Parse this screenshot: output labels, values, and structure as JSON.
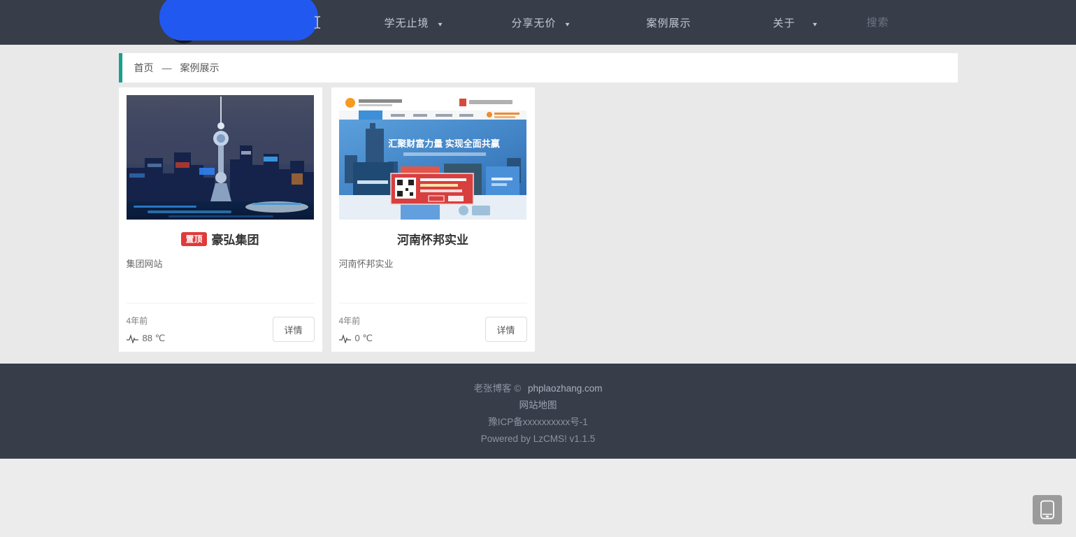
{
  "navbar": {
    "items": [
      {
        "label": "学无止境",
        "dropdown": true
      },
      {
        "label": "分享无价",
        "dropdown": true
      },
      {
        "label": "案例展示",
        "dropdown": false
      },
      {
        "label": "关于",
        "dropdown": true
      }
    ],
    "search_placeholder": "搜索"
  },
  "breadcrumb": {
    "home": "首页",
    "separator": "—",
    "current": "案例展示"
  },
  "cards": [
    {
      "badge": "置顶",
      "title": "豪弘集团",
      "description": "集团网站",
      "time": "4年前",
      "temperature": "88 ℃",
      "detail_label": "详情"
    },
    {
      "title": "河南怀邦实业",
      "description": "河南怀邦实业",
      "time": "4年前",
      "temperature": "0 ℃",
      "detail_label": "详情",
      "banner_text": "汇聚财富力量 实现全面共赢"
    }
  ],
  "footer": {
    "copyright_prefix": "老张博客 ©",
    "domain_link": "phplaozhang.com",
    "sitemap": "网站地图",
    "icp": "豫ICP备xxxxxxxxxx号-1",
    "powered": "Powered by LzCMS! v1.1.5"
  },
  "colors": {
    "navbar_bg": "#373d49",
    "accent_teal": "#18a08d",
    "badge_red": "#e03a3a",
    "blob_blue": "#2158f0",
    "content_bg": "#e9e9e9"
  }
}
